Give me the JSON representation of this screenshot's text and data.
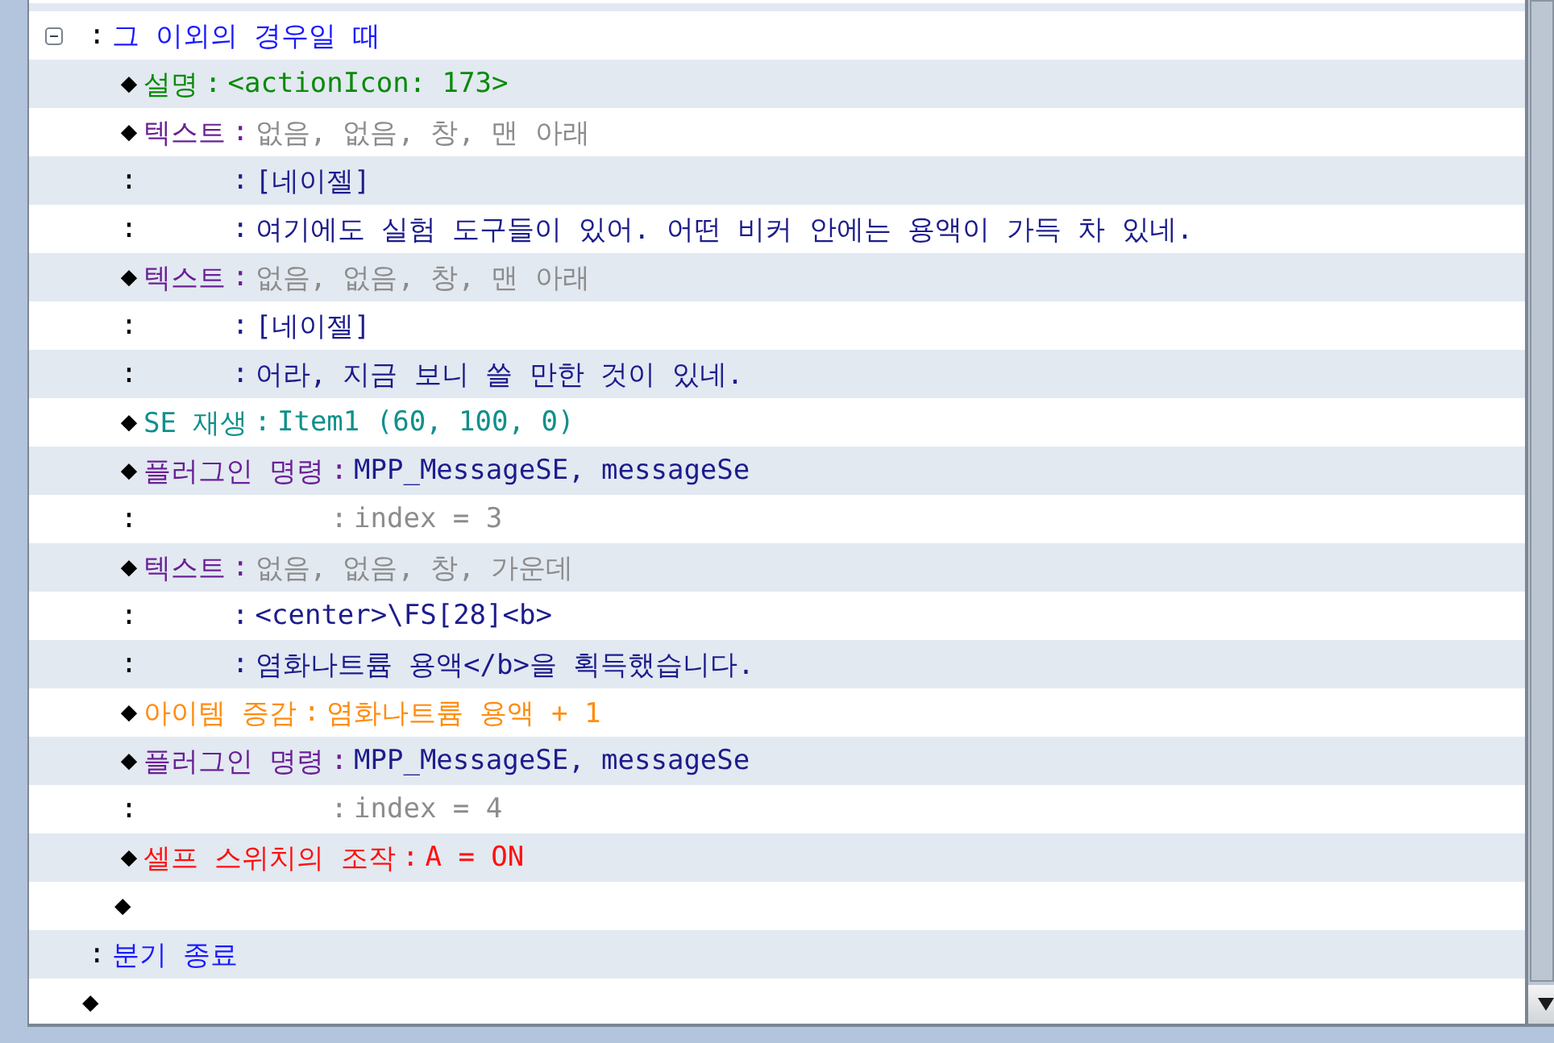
{
  "rows": [
    {
      "kind": "branch",
      "expanded": true,
      "colon": ":",
      "text": "그 이외의 경우일 때",
      "children": [
        {
          "kind": "comment",
          "marker": "◆",
          "label": "설명",
          "colon": ":",
          "value": "<actionIcon: 173>"
        },
        {
          "kind": "text",
          "marker": "◆",
          "label": "텍스트",
          "colon": ":",
          "value": "없음, 없음, 창, 맨 아래",
          "lines": [
            {
              "marker": ":",
              "colon": ":",
              "text": "[네이젤]"
            },
            {
              "marker": ":",
              "colon": ":",
              "text": "여기에도 실험 도구들이 있어. 어떤 비커 안에는 용액이 가득 차 있네."
            }
          ]
        },
        {
          "kind": "text",
          "marker": "◆",
          "label": "텍스트",
          "colon": ":",
          "value": "없음, 없음, 창, 맨 아래",
          "lines": [
            {
              "marker": ":",
              "colon": ":",
              "text": "[네이젤]"
            },
            {
              "marker": ":",
              "colon": ":",
              "text": "어라, 지금 보니 쓸 만한 것이 있네."
            }
          ]
        },
        {
          "kind": "se",
          "marker": "◆",
          "label": "SE 재생",
          "colon": ":",
          "value": "Item1 (60, 100, 0)"
        },
        {
          "kind": "plugin",
          "marker": "◆",
          "label": "플러그인 명령",
          "colon": ":",
          "value": "MPP_MessageSE, messageSe",
          "lines": [
            {
              "marker": ":",
              "colon": ":",
              "text": "index = 3"
            }
          ]
        },
        {
          "kind": "text",
          "marker": "◆",
          "label": "텍스트",
          "colon": ":",
          "value": "없음, 없음, 창, 가운데",
          "lines": [
            {
              "marker": ":",
              "colon": ":",
              "text": "<center>\\FS[28]<b>"
            },
            {
              "marker": ":",
              "colon": ":",
              "text": "염화나트륨 용액</b>을 획득했습니다."
            }
          ]
        },
        {
          "kind": "item",
          "marker": "◆",
          "label": "아이템 증감",
          "colon": ":",
          "value": "염화나트륨 용액 + 1"
        },
        {
          "kind": "plugin",
          "marker": "◆",
          "label": "플러그인 명령",
          "colon": ":",
          "value": "MPP_MessageSE, messageSe",
          "lines": [
            {
              "marker": ":",
              "colon": ":",
              "text": "index = 4"
            }
          ]
        },
        {
          "kind": "self_switch",
          "marker": "◆",
          "label": "셀프 스위치의 조작",
          "colon": ":",
          "value": "A = ON"
        },
        {
          "kind": "empty",
          "marker": "◆"
        }
      ]
    },
    {
      "kind": "branch_end",
      "colon": ":",
      "text": "분기 종료"
    },
    {
      "kind": "empty",
      "marker": "◆"
    }
  ]
}
